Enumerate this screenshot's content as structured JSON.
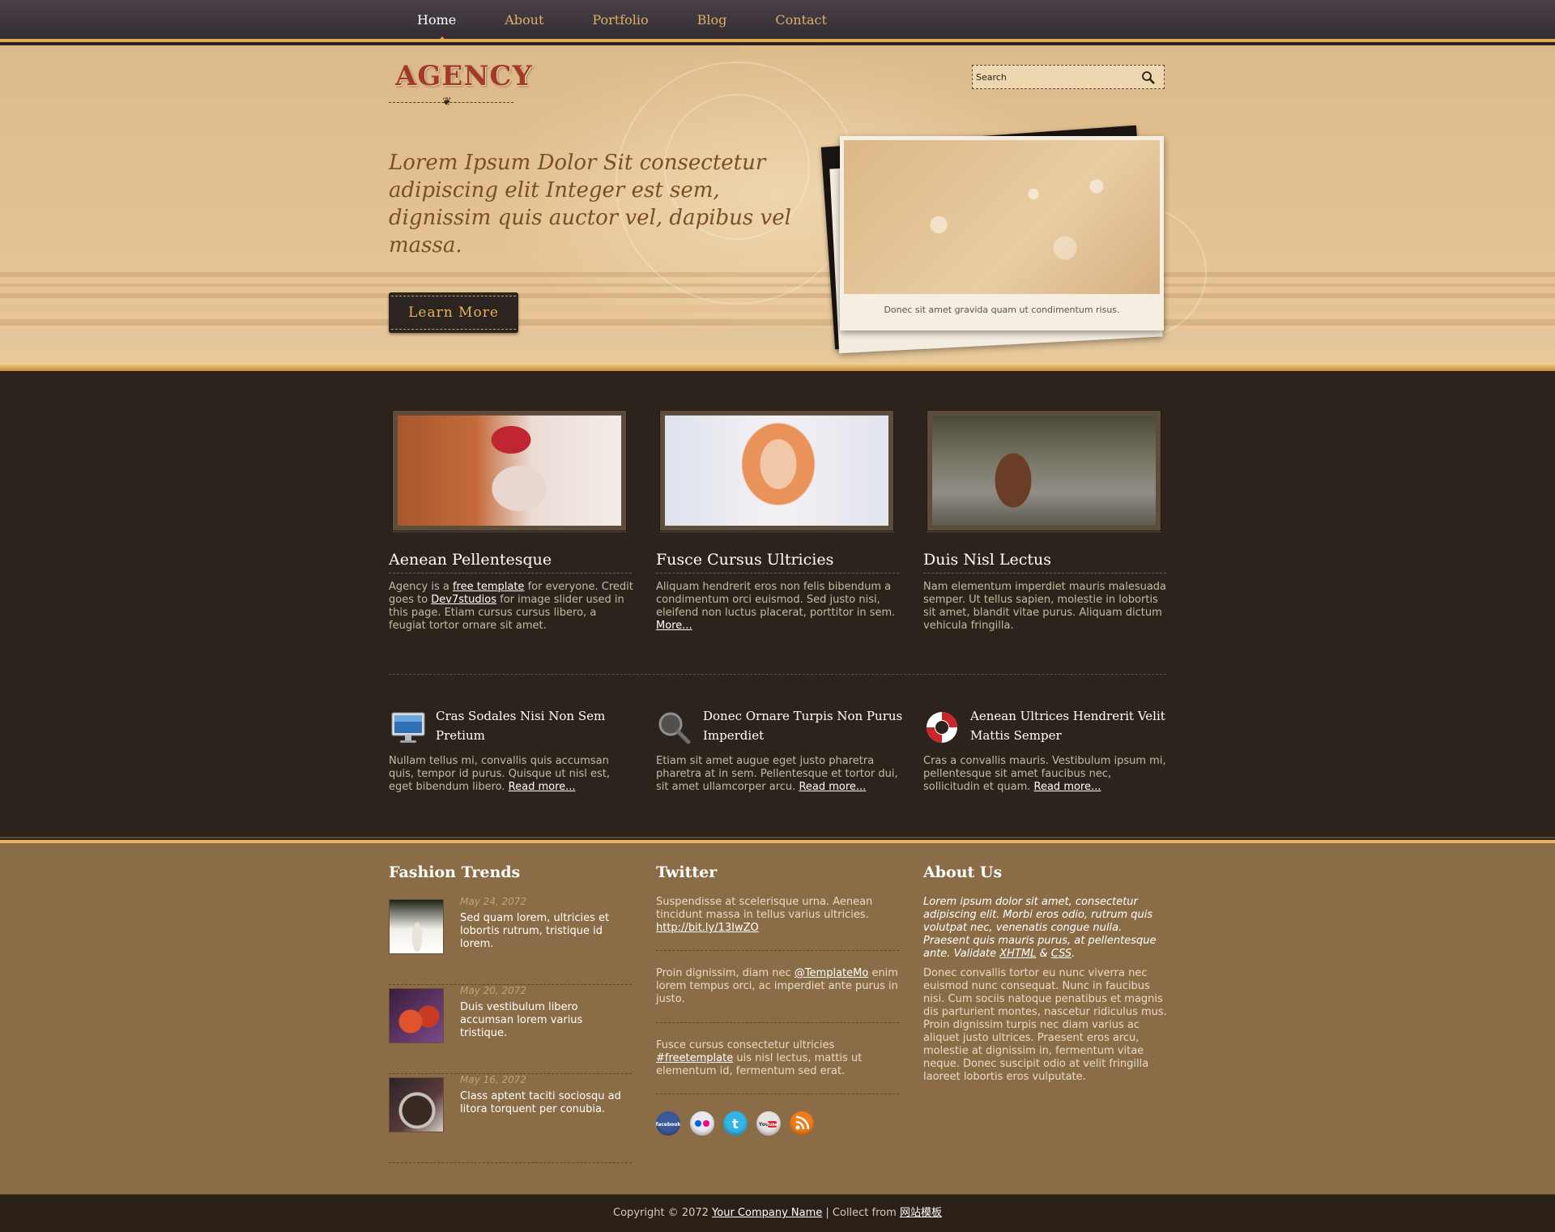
{
  "nav": {
    "items": [
      {
        "label": "Home"
      },
      {
        "label": "About"
      },
      {
        "label": "Portfolio"
      },
      {
        "label": "Blog"
      },
      {
        "label": "Contact"
      }
    ],
    "active": "Home"
  },
  "header": {
    "logo_text": "AGENCY",
    "search_placeholder": "Search"
  },
  "hero": {
    "headline": "Lorem Ipsum Dolor Sit consectetur adipiscing elit Integer est sem, dignissim quis auctor vel, dapibus vel massa.",
    "button_label": "Learn More",
    "slide_caption": "Donec sit amet gravida quam ut condimentum risus."
  },
  "features": [
    {
      "title": "Aenean Pellentesque",
      "text_1": "Agency is a ",
      "link_1": "free template",
      "text_2": " for everyone. Credit goes to ",
      "link_2": "Dev7studios",
      "text_3": " for image slider used in this page. Etiam cursus cursus libero, a feugiat tortor ornare sit amet."
    },
    {
      "title": "Fusce Cursus Ultricies",
      "text": "Aliquam hendrerit eros non felis bibendum a condimentum orci euismod. Sed justo nisi, eleifend non luctus placerat, porttitor in sem.",
      "link": "More..."
    },
    {
      "title": "Duis Nisl Lectus",
      "text": "Nam elementum imperdiet mauris malesuada semper. Ut tellus sapien, molestie in lobortis sit amet, blandit vitae purus. Aliquam dictum vehicula fringilla."
    }
  ],
  "services": [
    {
      "icon": "monitor-icon",
      "title": "Cras Sodales Nisi Non Sem Pretium",
      "text": "Nullam tellus mi, convallis quis accumsan quis, tempor id purus. Quisque ut nisl est, eget bibendum libero.",
      "link": "Read more..."
    },
    {
      "icon": "magnifier-icon",
      "title": "Donec Ornare Turpis Non Purus Imperdiet",
      "text": "Etiam sit amet augue eget justo pharetra pharetra at in sem. Pellentesque et tortor dui, sit amet ullamcorper arcu.",
      "link": "Read more..."
    },
    {
      "icon": "lifebuoy-icon",
      "title": "Aenean Ultrices Hendrerit Velit Mattis Semper",
      "text": "Cras a convallis mauris. Vestibulum ipsum mi, pellentesque sit amet faucibus nec, sollicitudin et quam.",
      "link": "Read more..."
    }
  ],
  "fashion": {
    "title": "Fashion Trends",
    "items": [
      {
        "date": "May 24, 2072",
        "text": "Sed quam lorem, ultricies et lobortis rutrum, tristique id lorem."
      },
      {
        "date": "May 20, 2072",
        "text": "Duis vestibulum libero accumsan lorem varius tristique."
      },
      {
        "date": "May 16, 2072",
        "text": "Class aptent taciti sociosqu ad litora torquent per conubia."
      }
    ]
  },
  "twitter": {
    "title": "Twitter",
    "tweets": [
      {
        "text": "Suspendisse at scelerisque urna. Aenean tincidunt massa in tellus varius ultricies. ",
        "link": "http://bit.ly/13IwZO",
        "after": ""
      },
      {
        "text": "Proin dignissim, diam nec ",
        "link": "@TemplateMo",
        "after": " enim lorem tempus orci, ac imperdiet ante purus in justo."
      },
      {
        "text": "Fusce cursus consectetur ultricies ",
        "link": "#freetemplate",
        "after": " uis nisl lectus, mattis ut elementum id, fermentum sed erat."
      }
    ],
    "social": [
      "facebook-icon",
      "flickr-icon",
      "twitter-icon",
      "youtube-icon",
      "rss-icon"
    ]
  },
  "about": {
    "title": "About Us",
    "intro": "Lorem ipsum dolor sit amet, consectetur adipiscing elit. Morbi eros odio, rutrum quis volutpat nec, venenatis congue nulla. Praesent quis mauris purus, at pellentesque ante. Validate ",
    "xhtml": "XHTML",
    "amp": " & ",
    "css": "CSS",
    "end": ".",
    "body": "Donec convallis tortor eu nunc viverra nec euismod nunc consequat. Nunc in faucibus nisi. Cum sociis natoque penatibus et magnis dis parturient montes, nascetur ridiculus mus. Proin dignissim turpis nec diam varius ac aliquet justo ultrices. Praesent eros arcu, molestie at dignissim in, fermentum vitae neque. Donec suscipit odio at velit fringilla laoreet lobortis eros vulputate."
  },
  "copyright": {
    "prefix": "Copyright © 2072 ",
    "company": "Your Company Name",
    "middle": " | Collect from ",
    "source": "网站模板"
  },
  "colors": {
    "accent": "#e3a84e",
    "dark_bg": "#2c241c",
    "footer_bg": "#8a6c47",
    "hero_bg": "#e2c191"
  }
}
